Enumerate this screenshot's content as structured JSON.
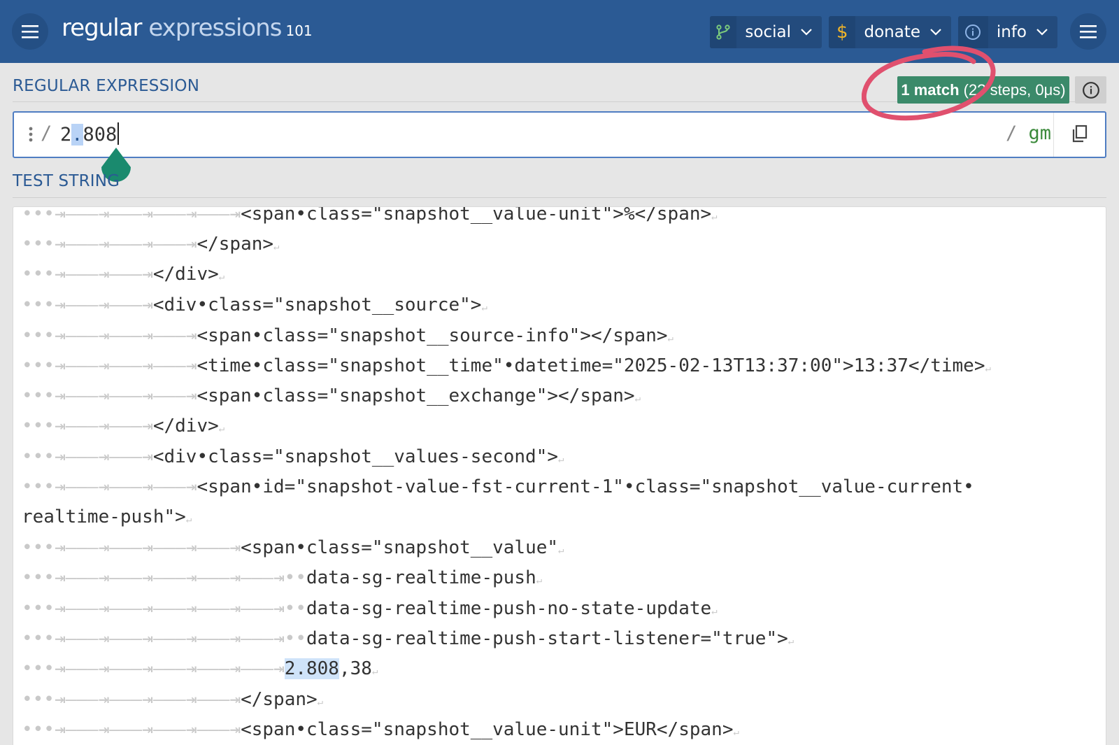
{
  "header": {
    "logo_main": "regular",
    "logo_sub": "expressions",
    "logo_version": "101",
    "nav": [
      {
        "label": "social",
        "icon": "git-branch-icon",
        "icon_color": "#7ccb7c"
      },
      {
        "label": "donate",
        "icon": "dollar-icon",
        "icon_color": "#f0b429"
      },
      {
        "label": "info",
        "icon": "info-circle-icon",
        "icon_color": "#8fb4e6"
      }
    ]
  },
  "regex": {
    "label": "REGULAR EXPRESSION",
    "match_count": "1 match",
    "match_detail": "(2? steps, 0μs)",
    "open_delim": "/",
    "value_prefix": "2",
    "value_dot": ".",
    "value_suffix": "808",
    "close_delim": "/ ",
    "flags": "gm"
  },
  "test_string": {
    "label": "TEST STRING",
    "lines": [
      {
        "indent": "•••⇥———⇥———⇥———⇥———⇥",
        "text": "<span•class=\"snapshot__value-unit\">%</span>",
        "eol": "↵"
      },
      {
        "indent": "•••⇥———⇥———⇥———⇥",
        "text": "</span>",
        "eol": "↵"
      },
      {
        "indent": "•••⇥———⇥———⇥",
        "text": "</div>",
        "eol": "↵"
      },
      {
        "indent": "•••⇥———⇥———⇥",
        "text": "<div•class=\"snapshot__source\">",
        "eol": "↵"
      },
      {
        "indent": "•••⇥———⇥———⇥———⇥",
        "text": "<span•class=\"snapshot__source-info\"></span>",
        "eol": "↵"
      },
      {
        "indent": "•••⇥———⇥———⇥———⇥",
        "text": "<time•class=\"snapshot__time\"•datetime=\"2025-02-13T13:37:00\">13:37</time>",
        "eol": "↵"
      },
      {
        "indent": "•••⇥———⇥———⇥———⇥",
        "text": "<span•class=\"snapshot__exchange\"></span>",
        "eol": "↵"
      },
      {
        "indent": "•••⇥———⇥———⇥",
        "text": "</div>",
        "eol": "↵"
      },
      {
        "indent": "•••⇥———⇥———⇥",
        "text": "<div•class=\"snapshot__values-second\">",
        "eol": "↵"
      },
      {
        "indent": "•••⇥———⇥———⇥———⇥",
        "text": "<span•id=\"snapshot-value-fst-current-1\"•class=\"snapshot__value-current•",
        "eol": ""
      },
      {
        "indent": "",
        "text": "realtime-push\">",
        "eol": "↵"
      },
      {
        "indent": "•••⇥———⇥———⇥———⇥———⇥",
        "text": "<span•class=\"snapshot__value\"",
        "eol": "↵"
      },
      {
        "indent": "•••⇥———⇥———⇥———⇥———⇥———⇥••",
        "text": "data-sg-realtime-push",
        "eol": "↵"
      },
      {
        "indent": "•••⇥———⇥———⇥———⇥———⇥———⇥••",
        "text": "data-sg-realtime-push-no-state-update",
        "eol": "↵"
      },
      {
        "indent": "•••⇥———⇥———⇥———⇥———⇥———⇥••",
        "text": "data-sg-realtime-push-start-listener=\"true\">",
        "eol": "↵"
      },
      {
        "indent": "•••⇥———⇥———⇥———⇥———⇥———⇥",
        "match": "2.808",
        "text": ",38",
        "eol": "↵"
      },
      {
        "indent": "•••⇥———⇥———⇥———⇥———⇥",
        "text": "</span>",
        "eol": "↵"
      },
      {
        "indent": "•••⇥———⇥———⇥———⇥———⇥",
        "text": "<span•class=\"snapshot__value-unit\">EUR</span>",
        "eol": "↵"
      }
    ]
  },
  "colors": {
    "header_bg": "#2b5a94",
    "label_blue": "#2b5a94",
    "match_badge": "#3b8a6a",
    "match_highlight": "#cfe3f9",
    "annotation": "#e0506e",
    "selection_handle": "#1a8a6e"
  }
}
